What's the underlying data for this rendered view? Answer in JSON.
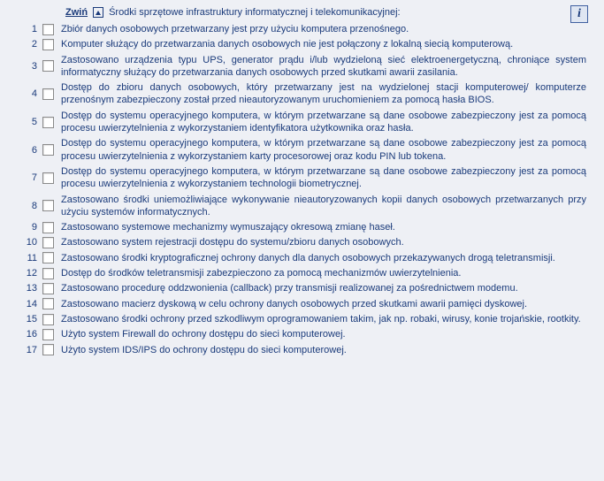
{
  "header": {
    "collapse_label": "Zwiń",
    "section_title": "Środki sprzętowe infrastruktury informatycznej i telekomunikacyjnej:",
    "info_glyph": "i"
  },
  "items": [
    {
      "n": "1",
      "text": "Zbiór danych osobowych przetwarzany jest przy użyciu komputera przenośnego."
    },
    {
      "n": "2",
      "text": "Komputer służący do przetwarzania danych osobowych nie jest połączony z lokalną siecią komputerową."
    },
    {
      "n": "3",
      "text": "Zastosowano urządzenia typu UPS, generator prądu i/lub wydzieloną sieć elektroenergetyczną, chroniące system informatyczny służący do przetwarzania danych osobowych przed skutkami awarii zasilania."
    },
    {
      "n": "4",
      "text": "Dostęp do zbioru danych osobowych, który przetwarzany jest na wydzielonej stacji komputerowej/ komputerze przenośnym zabezpieczony został przed nieautoryzowanym uruchomieniem za pomocą hasła BIOS."
    },
    {
      "n": "5",
      "text": "Dostęp do systemu operacyjnego komputera, w którym przetwarzane są dane osobowe zabezpieczony jest za pomocą procesu uwierzytelnienia z wykorzystaniem identyfikatora użytkownika oraz hasła."
    },
    {
      "n": "6",
      "text": "Dostęp do systemu operacyjnego komputera, w którym przetwarzane są dane osobowe zabezpieczony jest za pomocą procesu uwierzytelnienia z wykorzystaniem karty procesorowej oraz kodu PIN lub tokena."
    },
    {
      "n": "7",
      "text": "Dostęp do systemu operacyjnego komputera, w którym przetwarzane są dane osobowe zabezpieczony jest za pomocą procesu uwierzytelnienia z wykorzystaniem technologii biometrycznej."
    },
    {
      "n": "8",
      "text": "Zastosowano środki uniemożliwiające wykonywanie nieautoryzowanych kopii danych osobowych przetwarzanych przy użyciu systemów informatycznych."
    },
    {
      "n": "9",
      "text": "Zastosowano systemowe mechanizmy wymuszający okresową zmianę haseł."
    },
    {
      "n": "10",
      "text": "Zastosowano system rejestracji dostępu do systemu/zbioru danych osobowych."
    },
    {
      "n": "11",
      "text": "Zastosowano środki kryptograficznej ochrony danych dla danych osobowych przekazywanych drogą teletransmisji."
    },
    {
      "n": "12",
      "text": "Dostęp do środków teletransmisji zabezpieczono za pomocą mechanizmów uwierzytelnienia."
    },
    {
      "n": "13",
      "text": "Zastosowano procedurę oddzwonienia (callback) przy transmisji realizowanej za pośrednictwem modemu."
    },
    {
      "n": "14",
      "text": "Zastosowano macierz dyskową w celu ochrony danych osobowych przed skutkami awarii pamięci dyskowej."
    },
    {
      "n": "15",
      "text": "Zastosowano środki ochrony przed szkodliwym oprogramowaniem takim, jak np. robaki, wirusy, konie trojańskie, rootkity."
    },
    {
      "n": "16",
      "text": "Użyto system Firewall do ochrony dostępu do sieci komputerowej."
    },
    {
      "n": "17",
      "text": "Użyto system IDS/IPS do ochrony dostępu do sieci komputerowej."
    }
  ]
}
